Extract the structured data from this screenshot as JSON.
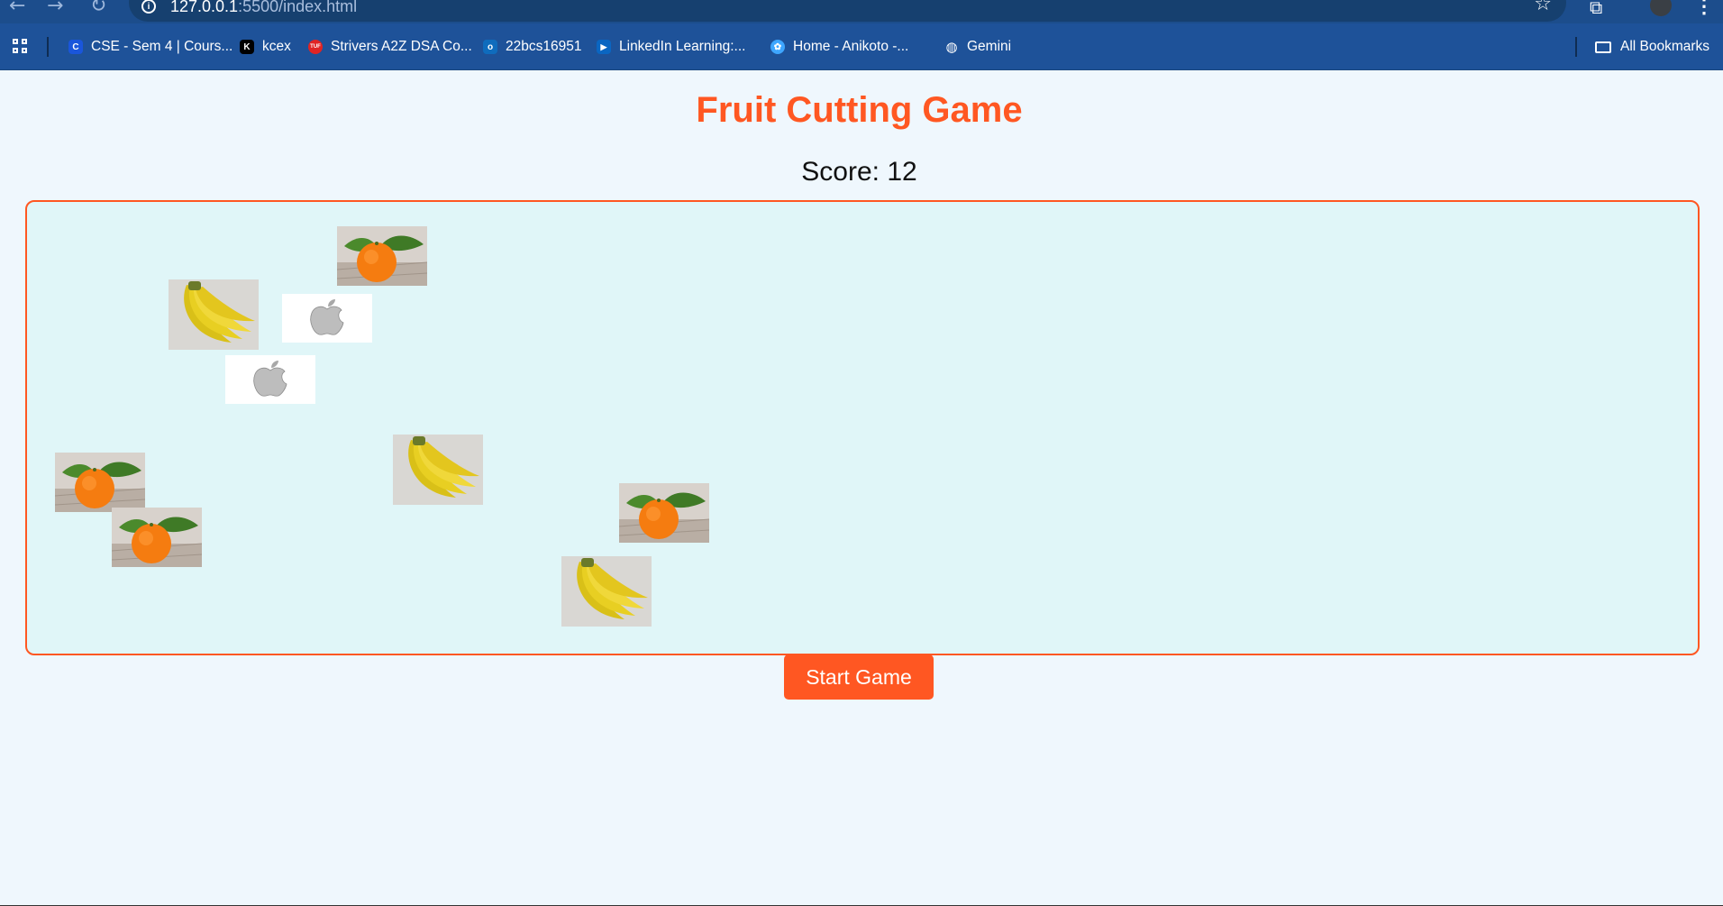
{
  "browser": {
    "url_host": "127.0.0.1",
    "url_rest": ":5500/index.html",
    "bookmarks": [
      {
        "label": "CSE - Sem 4 | Cours...",
        "icon": "c-logo-icon"
      },
      {
        "label": "kcex",
        "icon": "k-logo-icon"
      },
      {
        "label": "Strivers A2Z DSA Co...",
        "icon": "tuf-logo-icon"
      },
      {
        "label": "22bcs16951",
        "icon": "outlook-icon"
      },
      {
        "label": "LinkedIn Learning:...",
        "icon": "play-icon"
      },
      {
        "label": "Home - Anikoto -...",
        "icon": "anikoto-icon"
      },
      {
        "label": "Gemini",
        "icon": "globe-icon"
      }
    ],
    "all_bookmarks_label": "All Bookmarks",
    "all_bookmarks_icon": "folder-icon"
  },
  "page": {
    "title": "Fruit Cutting Game",
    "score_label": "Score: ",
    "score": 12,
    "start_button": "Start Game"
  },
  "fruits": [
    {
      "kind": "orange"
    },
    {
      "kind": "banana"
    },
    {
      "kind": "apple"
    },
    {
      "kind": "apple"
    },
    {
      "kind": "orange"
    },
    {
      "kind": "banana"
    },
    {
      "kind": "orange"
    },
    {
      "kind": "orange"
    },
    {
      "kind": "banana"
    }
  ],
  "colors": {
    "accent": "#ff5722",
    "game_bg": "#e0f6f8",
    "page_bg": "#eff7fd",
    "browser_bar": "#1e5299"
  }
}
